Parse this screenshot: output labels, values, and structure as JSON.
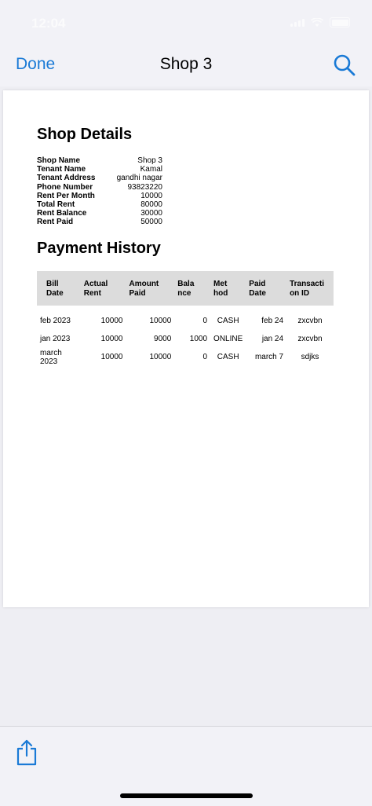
{
  "status": {
    "time": "12:04"
  },
  "nav": {
    "done_label": "Done",
    "title": "Shop 3"
  },
  "doc": {
    "details_heading": "Shop Details",
    "details": [
      {
        "label": "Shop Name",
        "value": "Shop 3"
      },
      {
        "label": "Tenant Name",
        "value": "Kamal"
      },
      {
        "label": "Tenant Address",
        "value": "gandhi nagar"
      },
      {
        "label": "Phone Number",
        "value": "93823220"
      },
      {
        "label": "Rent Per Month",
        "value": "10000"
      },
      {
        "label": "Total Rent",
        "value": "80000"
      },
      {
        "label": "Rent Balance",
        "value": "30000"
      },
      {
        "label": "Rent Paid",
        "value": "50000"
      }
    ],
    "history_heading": "Payment History",
    "columns": [
      "Bill Date",
      "Actual Rent",
      "Amount Paid",
      "Bala nce",
      "Met hod",
      "Paid Date",
      "Transacti on ID"
    ],
    "rows": [
      [
        "feb 2023",
        "10000",
        "10000",
        "0",
        "CASH",
        "feb 24",
        "zxcvbn"
      ],
      [
        "jan 2023",
        "10000",
        "9000",
        "1000",
        "ONLINE",
        "jan 24",
        "zxcvbn"
      ],
      [
        "march 2023",
        "10000",
        "10000",
        "0",
        "CASH",
        "march 7",
        "sdjks"
      ]
    ]
  },
  "icons": {
    "search": "search-icon",
    "share": "share-icon"
  },
  "colors": {
    "accent": "#1a7ad6",
    "header_row": "#dcdcdc"
  }
}
